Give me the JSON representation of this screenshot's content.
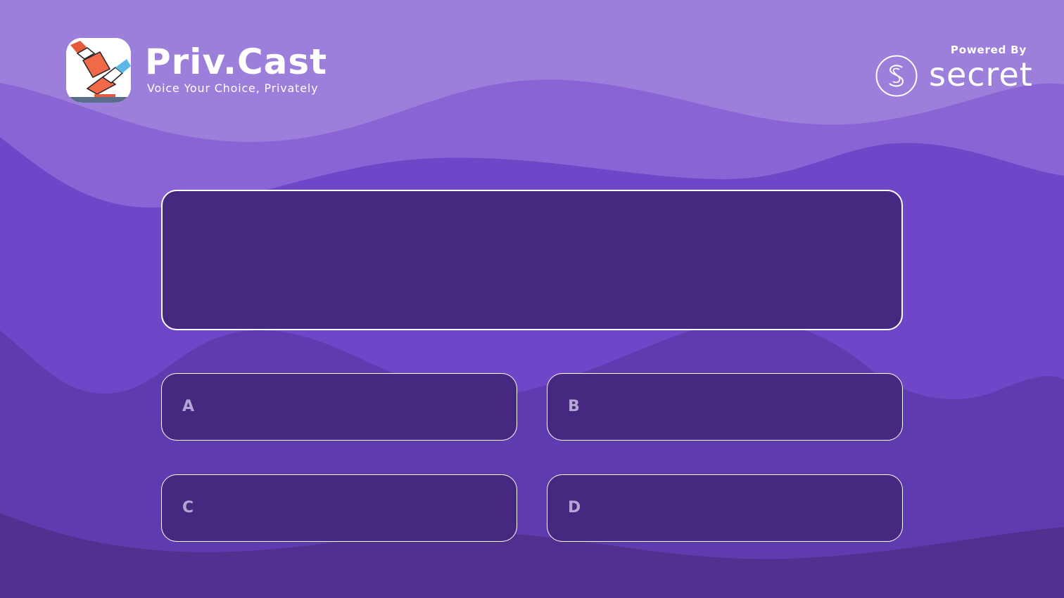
{
  "brand": {
    "title": "Priv.Cast",
    "tagline": "Voice Your Choice, Privately",
    "logo_icon": "ballot-hands-icon"
  },
  "powered_by": {
    "label": "Powered By",
    "wordmark": "secret",
    "logo_icon": "secret-s-icon"
  },
  "question": {
    "text": ""
  },
  "answers": [
    {
      "letter": "A",
      "text": ""
    },
    {
      "letter": "B",
      "text": ""
    },
    {
      "letter": "C",
      "text": ""
    },
    {
      "letter": "D",
      "text": ""
    }
  ],
  "colors": {
    "background_light": "#9c7fdb",
    "background_mid": "#7046c8",
    "background_dark": "#52308f",
    "panel": "#452981",
    "border": "#ffffff",
    "answer_letter": "#b4a6d3"
  }
}
